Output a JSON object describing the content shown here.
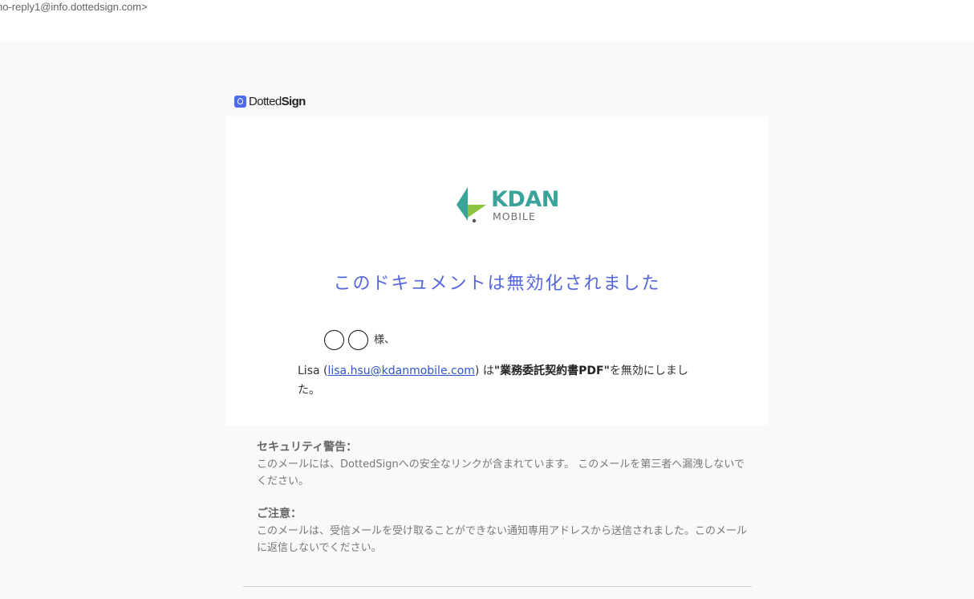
{
  "header": {
    "sender": "no-reply1@info.dottedsign.com>"
  },
  "brand": {
    "name_light": "Dotted",
    "name_bold": "Sign"
  },
  "logo": {
    "line1": "KDAN",
    "line2": "MOBILE",
    "teal_color": "#3aa39a",
    "green_color": "#8bc53f"
  },
  "card": {
    "title": "このドキュメントは無効化されました",
    "greeting_suffix": "様、",
    "body": {
      "sender_name": "Lisa",
      "open_paren": " (",
      "sender_email": "lisa.hsu@kdanmobile.com",
      "after_email": ") は",
      "doc_name": "\"業務委託契約書PDF\"",
      "after_doc": "を無効にしました。"
    }
  },
  "footer": {
    "security_heading": "セキュリティ警告：",
    "security_text": "このメールには、DottedSignへの安全なリンクが含まれています。 このメールを第三者へ漏洩しないでください。",
    "notice_heading": "ご注意：",
    "notice_text": "このメールは、受信メールを受け取ることができない通知専用アドレスから送信されました。このメールに返信しないでください。"
  }
}
